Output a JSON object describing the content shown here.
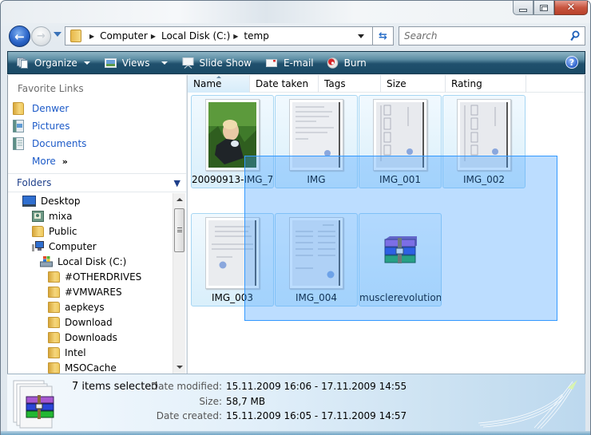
{
  "window": {
    "controls": {
      "minimize": "minimize",
      "maximize": "maximize",
      "close": "close"
    }
  },
  "navigation": {
    "breadcrumb": [
      "Computer",
      "Local Disk (C:)",
      "temp"
    ],
    "search_placeholder": "Search"
  },
  "toolbar": {
    "organize": "Organize",
    "views": "Views",
    "slideshow": "Slide Show",
    "email": "E-mail",
    "burn": "Burn",
    "help": "?"
  },
  "sidebar": {
    "favorites_title": "Favorite Links",
    "favorites": [
      {
        "label": "Denwer",
        "icon": "folder-icon"
      },
      {
        "label": "Pictures",
        "icon": "pictures-icon"
      },
      {
        "label": "Documents",
        "icon": "documents-icon"
      }
    ],
    "more_label": "More",
    "more_chevron": "»",
    "folders_title": "Folders",
    "folders_chevron": "⌄",
    "tree": [
      {
        "label": "Desktop",
        "icon": "desktop-icon",
        "level": 0
      },
      {
        "label": "mixa",
        "icon": "user-folder-icon",
        "level": 1
      },
      {
        "label": "Public",
        "icon": "folder-icon",
        "level": 1
      },
      {
        "label": "Computer",
        "icon": "computer-icon",
        "level": 1
      },
      {
        "label": "Local Disk (C:)",
        "icon": "drive-icon",
        "level": 2
      },
      {
        "label": "#OTHERDRIVES",
        "icon": "folder-icon",
        "level": 3
      },
      {
        "label": "#VMWARES",
        "icon": "folder-icon",
        "level": 3
      },
      {
        "label": "aepkeys",
        "icon": "folder-icon",
        "level": 3
      },
      {
        "label": "Download",
        "icon": "folder-icon",
        "level": 3
      },
      {
        "label": "Downloads",
        "icon": "folder-icon",
        "level": 3
      },
      {
        "label": "Intel",
        "icon": "folder-icon",
        "level": 3
      },
      {
        "label": "MSOCache",
        "icon": "folder-icon",
        "level": 3
      }
    ]
  },
  "columns": [
    "Name",
    "Date taken",
    "Tags",
    "Size",
    "Rating"
  ],
  "files": [
    {
      "name": "20090913-IMG_7...",
      "type": "photo",
      "selected": true
    },
    {
      "name": "IMG",
      "type": "scan",
      "selected": true
    },
    {
      "name": "IMG_001",
      "type": "scan",
      "selected": true
    },
    {
      "name": "IMG_002",
      "type": "scan",
      "selected": true
    },
    {
      "name": "IMG_003",
      "type": "scan",
      "selected": true
    },
    {
      "name": "IMG_004",
      "type": "scan",
      "selected": true
    },
    {
      "name": "musclerevolution_",
      "type": "archive",
      "selected": true
    }
  ],
  "details": {
    "count": "7 items selected",
    "date_modified_label": "Date modified:",
    "date_modified": "15.11.2009 16:06 - 17.11.2009 14:55",
    "size_label": "Size:",
    "size": "58,7 MB",
    "date_created_label": "Date created:",
    "date_created": "15.11.2009 16:05 - 17.11.2009 14:57"
  },
  "colors": {
    "link": "#1c5ac8",
    "selection": "#3399ff",
    "toolbar": "#1a4a66"
  }
}
